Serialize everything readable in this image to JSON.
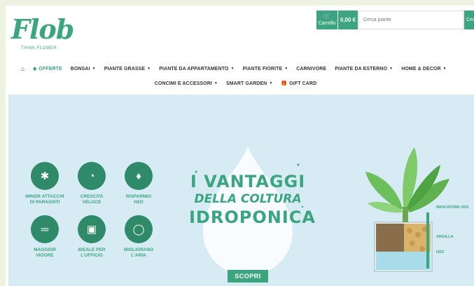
{
  "brand": {
    "logo": "Flob",
    "tagline": "THINK FLOWER"
  },
  "header": {
    "cart_label": "Carrello",
    "cart_total": "0,00 €",
    "search_placeholder": "Cerca piante",
    "search_button": "Cerca"
  },
  "nav": {
    "row1": [
      {
        "label": "OFFERTE",
        "dropdown": false,
        "icon": "tag-icon"
      },
      {
        "label": "BONSAI",
        "dropdown": true
      },
      {
        "label": "PIANTE GRASSE",
        "dropdown": true
      },
      {
        "label": "PIANTE DA APPARTAMENTO",
        "dropdown": true
      },
      {
        "label": "PIANTE FIORITE",
        "dropdown": true
      },
      {
        "label": "CARNIVORE",
        "dropdown": false
      },
      {
        "label": "PIANTE DA ESTERNO",
        "dropdown": true
      },
      {
        "label": "HOME & DECOR",
        "dropdown": true
      }
    ],
    "row2": [
      {
        "label": "CONCIMI E ACCESSORI",
        "dropdown": true
      },
      {
        "label": "SMART GARDEN",
        "dropdown": true
      },
      {
        "label": "GIFT CARD",
        "dropdown": false,
        "icon": "gift-icon"
      }
    ]
  },
  "hero": {
    "benefits": [
      {
        "icon": "bug-icon",
        "line1": "MINOR ATTACCHI",
        "line2": "DI PARASSITI"
      },
      {
        "icon": "speedometer-icon",
        "line1": "CRESCITA",
        "line2": "VELOCE"
      },
      {
        "icon": "water-drop-icon",
        "line1": "RISPARMIO",
        "line2": "H2O"
      },
      {
        "icon": "dumbbell-icon",
        "line1": "MAGGIOR",
        "line2": "VIGORE"
      },
      {
        "icon": "monitor-icon",
        "line1": "IDEALE PER",
        "line2": "L'UFFICIO"
      },
      {
        "icon": "co2-icon",
        "line1": "MIGLIORANO",
        "line2": "L'ARIA"
      }
    ],
    "headline": {
      "line1": "I VANTAGGI",
      "line2": "DELLA COLTURA",
      "line3": "IDROPONICA"
    },
    "cta": "SCOPRI",
    "diagram_labels": {
      "indicator": "INDICATORE H2O",
      "clay": "ARGILLA",
      "water": "H2O"
    }
  },
  "colors": {
    "brand_green": "#3aa57e",
    "dark_green": "#2f8a69",
    "hero_bg": "#d7ebf5"
  }
}
